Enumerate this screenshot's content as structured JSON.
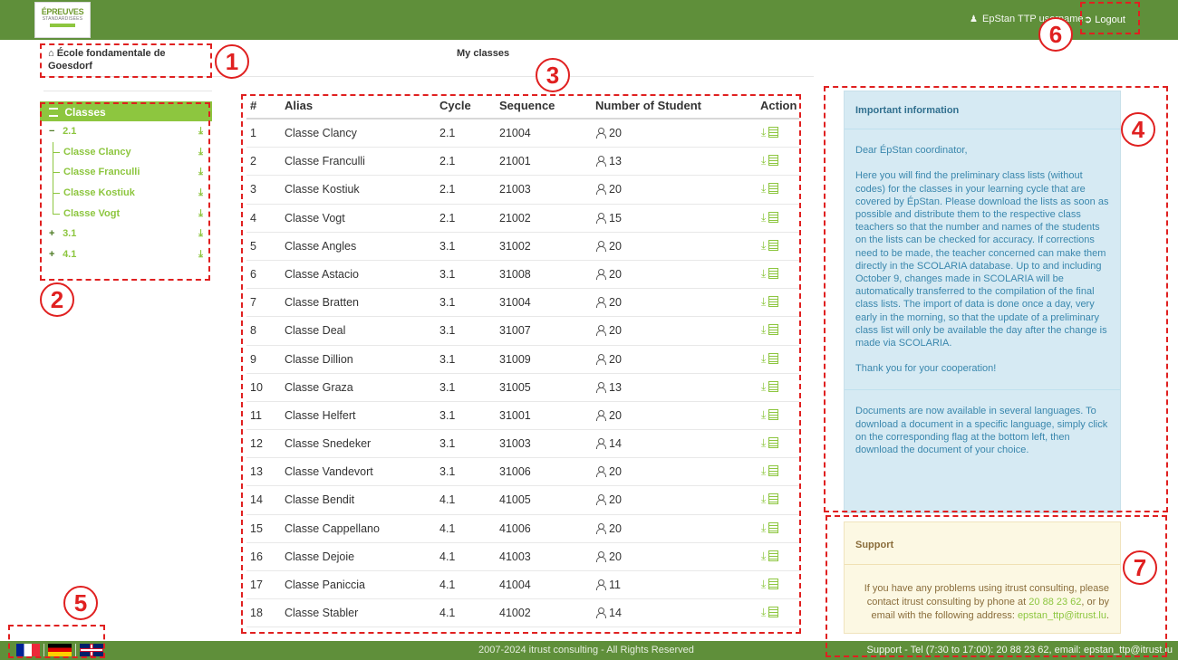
{
  "header": {
    "logo": {
      "line1": "ÉPREUVES",
      "line2": "STANDARDISÉES",
      "line3": "TTP"
    },
    "username": "EpStan TTP username",
    "logout_label": "Logout"
  },
  "school_name": "École fondamentale de Goesdorf",
  "page_title": "My classes",
  "sidebar": {
    "title": "Classes",
    "groups": [
      {
        "label": "2.1",
        "expanded": true,
        "items": [
          "Classe Clancy",
          "Classe Franculli",
          "Classe Kostiuk",
          "Classe Vogt"
        ]
      },
      {
        "label": "3.1",
        "expanded": false,
        "items": []
      },
      {
        "label": "4.1",
        "expanded": false,
        "items": []
      }
    ]
  },
  "table": {
    "columns": [
      "#",
      "Alias",
      "Cycle",
      "Sequence",
      "Number of Student",
      "Action"
    ],
    "rows": [
      [
        "1",
        "Classe Clancy",
        "2.1",
        "21004",
        "20"
      ],
      [
        "2",
        "Classe Franculli",
        "2.1",
        "21001",
        "13"
      ],
      [
        "3",
        "Classe Kostiuk",
        "2.1",
        "21003",
        "20"
      ],
      [
        "4",
        "Classe Vogt",
        "2.1",
        "21002",
        "15"
      ],
      [
        "5",
        "Classe Angles",
        "3.1",
        "31002",
        "20"
      ],
      [
        "6",
        "Classe Astacio",
        "3.1",
        "31008",
        "20"
      ],
      [
        "7",
        "Classe Bratten",
        "3.1",
        "31004",
        "20"
      ],
      [
        "8",
        "Classe Deal",
        "3.1",
        "31007",
        "20"
      ],
      [
        "9",
        "Classe Dillion",
        "3.1",
        "31009",
        "20"
      ],
      [
        "10",
        "Classe Graza",
        "3.1",
        "31005",
        "13"
      ],
      [
        "11",
        "Classe Helfert",
        "3.1",
        "31001",
        "20"
      ],
      [
        "12",
        "Classe Snedeker",
        "3.1",
        "31003",
        "14"
      ],
      [
        "13",
        "Classe Vandevort",
        "3.1",
        "31006",
        "20"
      ],
      [
        "14",
        "Classe Bendit",
        "4.1",
        "41005",
        "20"
      ],
      [
        "15",
        "Classe Cappellano",
        "4.1",
        "41006",
        "20"
      ],
      [
        "16",
        "Classe Dejoie",
        "4.1",
        "41003",
        "20"
      ],
      [
        "17",
        "Classe Paniccia",
        "4.1",
        "41004",
        "11"
      ],
      [
        "18",
        "Classe Stabler",
        "4.1",
        "41002",
        "14"
      ]
    ]
  },
  "info": {
    "title": "Important information",
    "greeting": "Dear ÉpStan coordinator,",
    "body": "Here you will find the preliminary class lists (without codes) for the classes in your learning cycle that are covered by ÉpStan. Please download the lists as soon as possible and distribute them to the respective class teachers so that the number and names of the students on the lists can be checked for accuracy. If corrections need to be made, the teacher concerned can make them directly in the SCOLARIA database. Up to and including October 9, changes made in SCOLARIA will be automatically transferred to the compilation of the final class lists. The import of data is done once a day, very early in the morning, so that the update of a preliminary class list will only be available the day after the change is made via SCOLARIA.",
    "thanks": "Thank you for your cooperation!",
    "languages_note": "Documents are now available in several languages. To download a document in a specific language, simply click on the corresponding flag at the bottom left, then download the document of your choice."
  },
  "support": {
    "title": "Support",
    "text_before": "If you have any problems using itrust consulting, please contact itrust consulting by phone at ",
    "phone": "20 88 23 62",
    "text_mid": ", or by email with the following address: ",
    "email": "epstan_ttp@itrust.lu",
    "text_end": "."
  },
  "footer": {
    "copyright": "2007-2024 itrust consulting - All Rights Reserved",
    "support": "Support - Tel (7:30 to 17:00): 20 88 23 62, email: epstan_ttp@itrust.lu"
  },
  "callouts": [
    "1",
    "2",
    "3",
    "4",
    "5",
    "6",
    "7"
  ],
  "colors": {
    "header_green": "#5f8f3a",
    "accent_green": "#8dc63f",
    "annotation_red": "#e02020",
    "info_bg": "#d6eaf3",
    "support_bg": "#fcf8e3"
  }
}
